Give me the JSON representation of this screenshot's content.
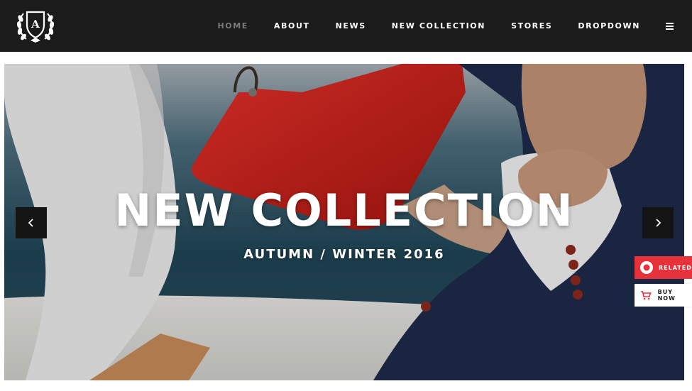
{
  "brand": {
    "logo_letter": "A"
  },
  "nav": {
    "items": [
      {
        "label": "HOME",
        "active": true
      },
      {
        "label": "ABOUT",
        "active": false
      },
      {
        "label": "NEWS",
        "active": false
      },
      {
        "label": "NEW COLLECTION",
        "active": false
      },
      {
        "label": "STORES",
        "active": false
      },
      {
        "label": "DROPDOWN",
        "active": false
      }
    ],
    "menu_icon": "hamburger-icon"
  },
  "hero": {
    "title": "NEW COLLECTION",
    "subtitle": "AUTUMN / WINTER 2016",
    "prev_icon": "chevron-left-icon",
    "next_icon": "chevron-right-icon"
  },
  "side_actions": {
    "related": {
      "label": "RELATED",
      "icon": "location-pin-icon",
      "color": "#e5323b"
    },
    "buy_now": {
      "label": "BUY NOW",
      "icon": "cart-icon",
      "color": "#e5323b"
    }
  },
  "colors": {
    "topbar": "#1b1b1b",
    "nav_active": "#7a7a7a",
    "accent": "#e5323b",
    "bag": "#d3211d",
    "jacket": "#1e2b4a"
  }
}
